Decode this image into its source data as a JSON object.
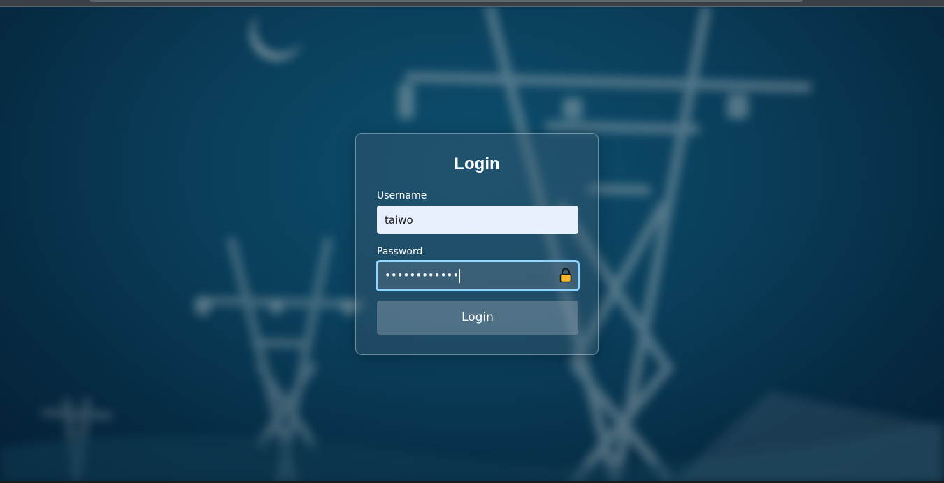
{
  "login": {
    "title": "Login",
    "username_label": "Username",
    "username_value": "taiwo",
    "password_label": "Password",
    "password_masked": "••••••••••••",
    "button_label": "Login",
    "lock_icon": "lock-icon"
  },
  "colors": {
    "background": "#0a3f5c",
    "focus_border": "#8fd3ff",
    "username_field": "#e7f0fd",
    "lock_body": "#f5b82e"
  }
}
